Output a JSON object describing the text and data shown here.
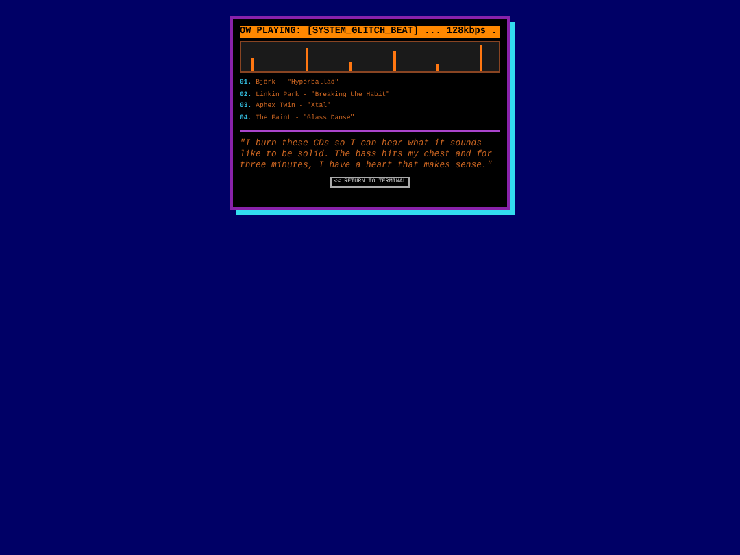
{
  "ticker": "OW PLAYING: [SYSTEM_GLITCH_BEAT] ... 128kbps .",
  "tracks": [
    {
      "number": "01.",
      "title": "Björk - \"Hyperballad\""
    },
    {
      "number": "02.",
      "title": "Linkin Park - \"Breaking the Habit\""
    },
    {
      "number": "03.",
      "title": "Aphex Twin - \"Xtal\""
    },
    {
      "number": "04.",
      "title": "The Faint - \"Glass Danse\""
    }
  ],
  "quote": "\"I burn these CDs so I can hear what it sounds like to be solid. The bass hits my chest and for three minutes, I have a heart that makes sense.\"",
  "button": "<< RETURN TO TERMINAL"
}
